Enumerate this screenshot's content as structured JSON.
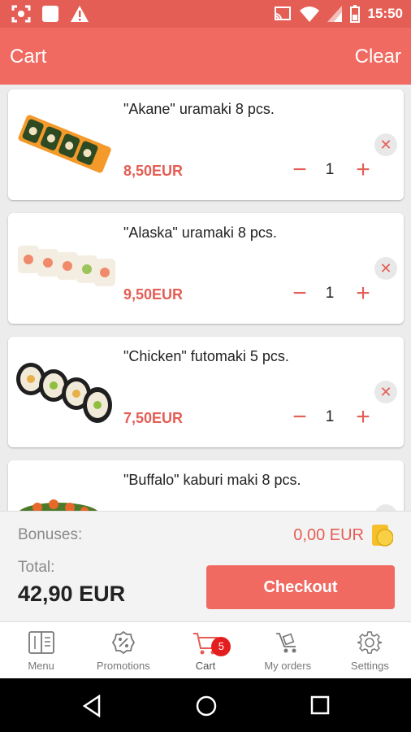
{
  "status_bar": {
    "time": "15:50"
  },
  "app_bar": {
    "title": "Cart",
    "clear_label": "Clear"
  },
  "items": [
    {
      "name": "\"Akane\" uramaki 8 pcs.",
      "price": "8,50EUR",
      "qty": "1"
    },
    {
      "name": "\"Alaska\" uramaki 8 pcs.",
      "price": "9,50EUR",
      "qty": "1"
    },
    {
      "name": "\"Chicken\" futomaki 5 pcs.",
      "price": "7,50EUR",
      "qty": "1"
    },
    {
      "name": "\"Buffalo\" kaburi maki 8 pcs."
    }
  ],
  "summary": {
    "bonuses_label": "Bonuses:",
    "bonuses_value": "0,00 EUR",
    "total_label": "Total:",
    "total_value": "42,90 EUR",
    "checkout_label": "Checkout"
  },
  "nav": {
    "items": [
      {
        "label": "Menu",
        "icon": "menu-book-icon"
      },
      {
        "label": "Promotions",
        "icon": "percent-badge-icon"
      },
      {
        "label": "Cart",
        "icon": "cart-icon",
        "badge": "5"
      },
      {
        "label": "My orders",
        "icon": "orders-cart-icon"
      },
      {
        "label": "Settings",
        "icon": "gear-icon"
      }
    ]
  },
  "colors": {
    "accent": "#f06a62",
    "status_bar": "#e45e55",
    "price": "#e45e55"
  }
}
